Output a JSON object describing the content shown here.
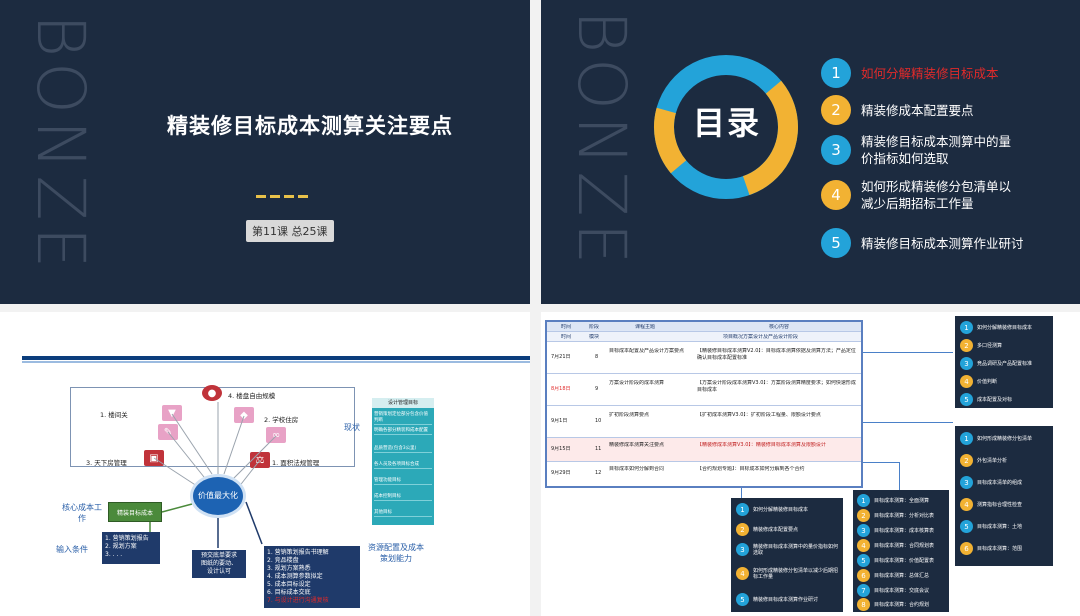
{
  "slide1": {
    "watermark": "BONZE",
    "title": "精装修目标成本测算关注要点",
    "chip": "第11课 总25课"
  },
  "slide2": {
    "watermark": "BONZE",
    "center": "目录",
    "items": [
      {
        "n": "1",
        "text": "如何分解精装修目标成本",
        "highlight": true
      },
      {
        "n": "2",
        "text": "精装修成本配置要点"
      },
      {
        "n": "3",
        "text": "精装修目标成本测算中的量价指标如何选取"
      },
      {
        "n": "4",
        "text": "如何形成精装修分包清单以减少后期招标工作量"
      },
      {
        "n": "5",
        "text": "精装修目标成本测算作业研讨"
      }
    ]
  },
  "slide3": {
    "labels": {
      "top_right": "4. 楼盘自由规模",
      "house": "1. 楼间关",
      "school": "2. 学校住房",
      "hot": "3. 天下房管理",
      "law": "1. 面积法规管理",
      "current": "现状",
      "core": "核心成本工作",
      "input": "输入条件",
      "resource": "资源配置及成本策划能力"
    },
    "value_center": "价值最大化",
    "green_box": "精装目标成本",
    "input_list": [
      "1. 营销策划报告",
      "2. 规划方案",
      "3. . . ."
    ],
    "mid_box": "预交底单要求\n图纸的要动、\n设计认可",
    "steps": [
      "1. 营销策划报告书理解",
      "2. 竞品楼盘",
      "3. 规划方案熟悉",
      "4. 成本测算参数拟定",
      "5. 成本目标设定",
      "6. 目标成本交底",
      "7. 与设计进行沟通复核"
    ],
    "side_header": "设计管理目标",
    "side_rows": [
      "营销策划定位部分包含价值判断",
      "明确各部分精装和成本配置",
      "品质营造(包含3公里)",
      "各人员及各项目标合成",
      "管理功能目标",
      "成本控制目标",
      "其他目标"
    ]
  },
  "slide4": {
    "table": {
      "headers": [
        "时间",
        "阶段",
        "课程主题",
        "核心内容"
      ],
      "sub": [
        "时间",
        "模块",
        "项目概况方案设计及产品设计阶段"
      ],
      "rows": [
        {
          "date": "7月21日",
          "no": "8",
          "topic": "目标成本配置及产品设计方案要点",
          "content": "【精装修目标成本测算V2.0】：目标成本测算依据及测算方法；产品定位确认目标成本配置标准"
        },
        {
          "date": "8月18日",
          "no": "9",
          "topic": "方案设计阶段的成本测算",
          "content": "【方案设计阶段成本测算V3.0】：方案阶段测算精度要求；如何快速形成目标成本"
        },
        {
          "date": "9月1日",
          "no": "10",
          "topic": "扩初阶段测算要点",
          "content": "【扩初成本测算V3.0】：扩初阶段工程量、限额设计要点"
        },
        {
          "date": "9月15日",
          "no": "11",
          "topic": "精装修成本测算关注要点",
          "content": "【精装修成本测算V3.0】：精装修目标成本测算及限额设计"
        },
        {
          "date": "9月29日",
          "no": "12",
          "topic": "目标成本如何分解到合同",
          "content": "【合约规划专题】：目标成本如何分解到各个合约"
        }
      ]
    },
    "panel_a": [
      "如何分解精装修目标成本",
      "多口径测算",
      "竞品调研及产品配置标准",
      "价值判断",
      "成本配置及对标"
    ],
    "panel_b": [
      "如何形成精装修分包清单",
      "外包清单分析",
      "目标成本清单的组成",
      "测算指标合理性检查",
      "目标成本测算：土地",
      "目标成本测算：范围"
    ],
    "panel_c": [
      "如何分解精装修目标成本",
      "精装修成本配置要点",
      "精装修目标成本测算中的量价指标如何选取",
      "如何形成精装修分包清单以减少后期招标工作量",
      "精装修目标成本测算作业研讨"
    ],
    "panel_d": [
      "目标成本测算：全面测算",
      "目标成本测算：分析对比表",
      "目标成本测算：成本核算表",
      "目标成本测算：合同规划表",
      "目标成本测算：价值配置表",
      "目标成本测算：总体汇总",
      "目标成本测算：交底会议",
      "目标成本测算：合约规划"
    ]
  }
}
